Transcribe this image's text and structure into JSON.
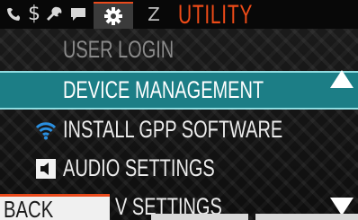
{
  "header": {
    "title": "UTILITY",
    "tabs": [
      {
        "name": "phone",
        "icon": "phone-icon"
      },
      {
        "name": "dollar",
        "icon": "dollar-icon"
      },
      {
        "name": "tools",
        "icon": "wrench-icon"
      },
      {
        "name": "messages",
        "icon": "chat-bubble-icon"
      },
      {
        "name": "settings",
        "icon": "gear-icon",
        "active": true
      },
      {
        "name": "sleep",
        "icon": "sleep-z-icon"
      }
    ],
    "accent_color": "#ee4b18"
  },
  "menu": {
    "items": [
      {
        "label": "USER LOGIN",
        "state": "dim"
      },
      {
        "label": "DEVICE MANAGEMENT",
        "state": "selected"
      },
      {
        "label": "INSTALL GPP SOFTWARE",
        "icon": "wifi-icon"
      },
      {
        "label": "AUDIO SETTINGS",
        "icon": "speaker-icon"
      },
      {
        "label": "V SETTINGS",
        "state": "partially-hidden"
      }
    ],
    "selected_color": "#1c7e86"
  },
  "softkeys": {
    "back_label": "BACK"
  }
}
